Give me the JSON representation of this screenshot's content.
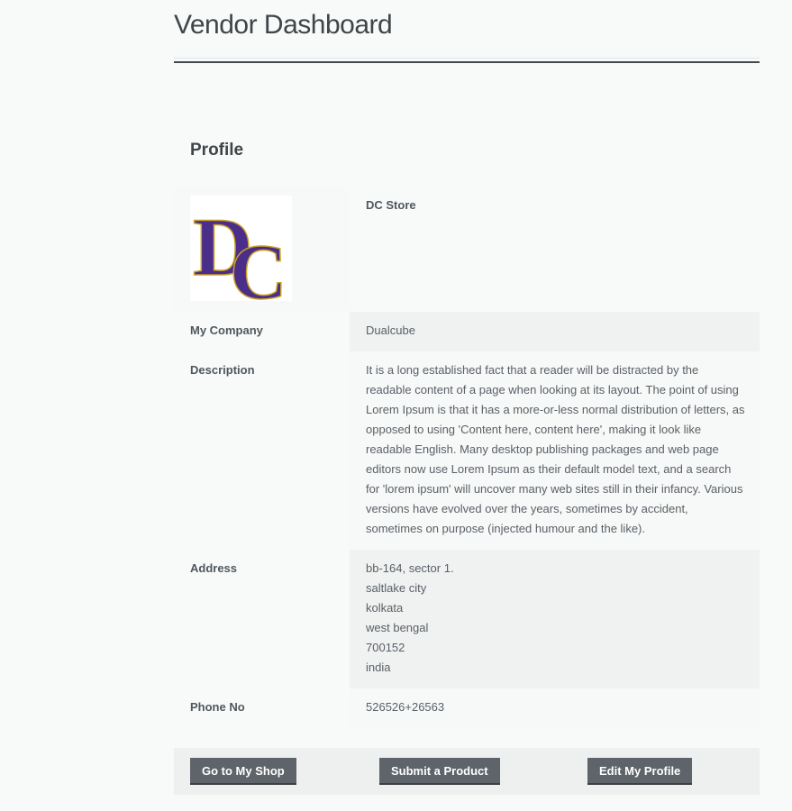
{
  "page": {
    "title": "Vendor Dashboard"
  },
  "profile": {
    "section_title": "Profile",
    "store_name": "DC Store",
    "logo_text": "DC",
    "rows": {
      "company": {
        "label": "My Company",
        "value": "Dualcube"
      },
      "description": {
        "label": "Description",
        "value": "It is a long established fact that a reader will be distracted by the readable content of a page when looking at its layout. The point of using Lorem Ipsum is that it has a more-or-less normal distribution of letters, as opposed to using 'Content here, content here', making it look like readable English. Many desktop publishing packages and web page editors now use Lorem Ipsum as their default model text, and a search for 'lorem ipsum' will uncover many web sites still in their infancy. Various versions have evolved over the years, sometimes by accident, sometimes on purpose (injected humour and the like)."
      },
      "address": {
        "label": "Address",
        "lines": [
          "bb-164, sector 1.",
          "saltlake city",
          "kolkata",
          "west bengal",
          "700152",
          "india"
        ]
      },
      "phone": {
        "label": "Phone No",
        "value": "526526+26563"
      }
    }
  },
  "actions": {
    "shop_label": "Go to My Shop",
    "submit_label": "Submit a Product",
    "edit_label": "Edit My Profile"
  },
  "colors": {
    "logo_fill": "#4b2d8a",
    "logo_outline": "#c9a227",
    "button_bg": "#5e646a"
  }
}
